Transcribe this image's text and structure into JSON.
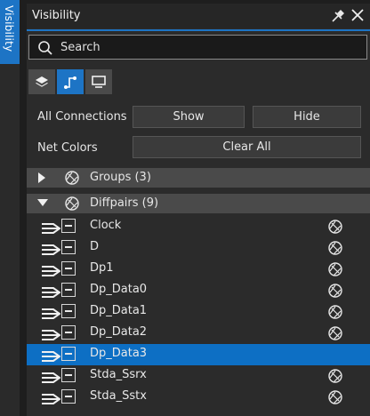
{
  "side_tab": {
    "label": "Visibility"
  },
  "header": {
    "title": "Visibility",
    "pin_icon": "pin-icon",
    "close_icon": "close-icon"
  },
  "search": {
    "label": "Search",
    "icon": "search-icon"
  },
  "toolbar": {
    "buttons": [
      {
        "icon": "layers-icon",
        "active": false
      },
      {
        "icon": "connection-icon",
        "active": true
      },
      {
        "icon": "monitor-icon",
        "active": false
      }
    ]
  },
  "all_connections": {
    "label": "All Connections",
    "show": "Show",
    "hide": "Hide"
  },
  "net_colors": {
    "label": "Net Colors",
    "clear_all": "Clear All"
  },
  "groups": {
    "label": "Groups (3)",
    "expanded": false
  },
  "diffpairs": {
    "label": "Diffpairs (9)",
    "expanded": true,
    "items": [
      {
        "name": "Clock",
        "selected": false,
        "net_icon": true
      },
      {
        "name": "D",
        "selected": false,
        "net_icon": true
      },
      {
        "name": "Dp1",
        "selected": false,
        "net_icon": true
      },
      {
        "name": "Dp_Data0",
        "selected": false,
        "net_icon": true
      },
      {
        "name": "Dp_Data1",
        "selected": false,
        "net_icon": true
      },
      {
        "name": "Dp_Data2",
        "selected": false,
        "net_icon": true
      },
      {
        "name": "Dp_Data3",
        "selected": true,
        "net_icon": false
      },
      {
        "name": "Stda_Ssrx",
        "selected": false,
        "net_icon": true
      },
      {
        "name": "Stda_Sstx",
        "selected": false,
        "net_icon": true
      }
    ]
  },
  "colors": {
    "accent": "#1d74c5",
    "selected": "#0d6fc4",
    "panel": "#2b2b2b",
    "section": "#4a4a4a"
  }
}
